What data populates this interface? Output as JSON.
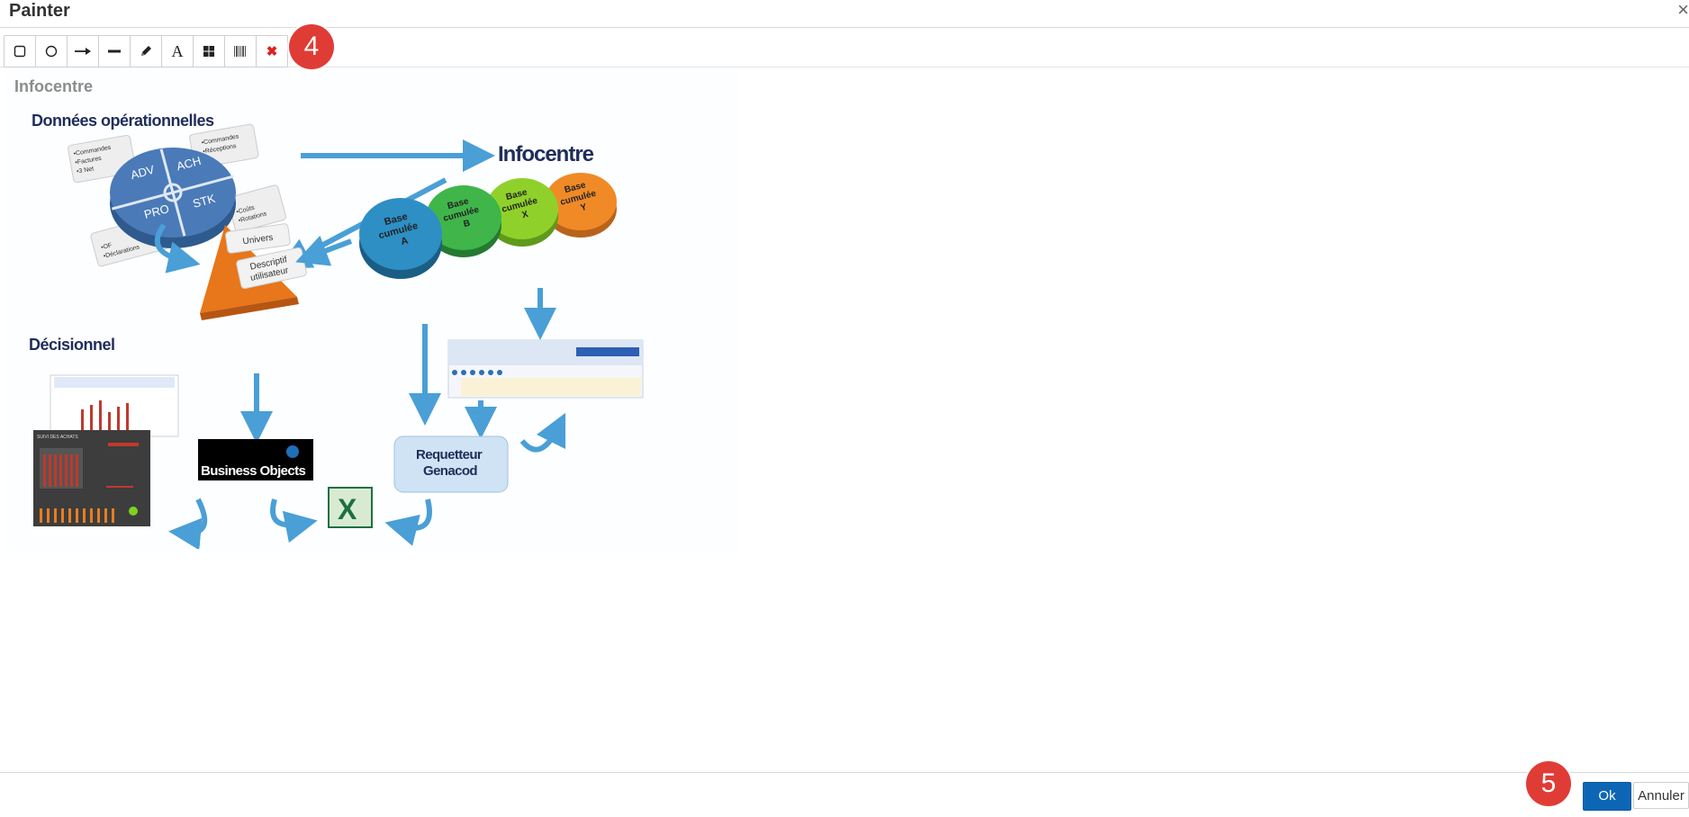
{
  "window": {
    "title": "Painter",
    "close_symbol": "×"
  },
  "toolbar": {
    "tools": [
      {
        "name": "rectangle-tool",
        "icon": "square-icon"
      },
      {
        "name": "circle-tool",
        "icon": "circle-icon"
      },
      {
        "name": "arrow-tool",
        "icon": "arrow-right-icon"
      },
      {
        "name": "line-tool",
        "icon": "line-icon"
      },
      {
        "name": "pencil-tool",
        "icon": "pencil-icon"
      },
      {
        "name": "text-tool",
        "icon": "text-a-icon",
        "glyph": "A"
      },
      {
        "name": "grid-tool",
        "icon": "grid-icon"
      },
      {
        "name": "barcode-tool",
        "icon": "barcode-icon"
      },
      {
        "name": "delete-tool",
        "icon": "red-x-icon",
        "glyph": "✖",
        "color": "#e02020"
      }
    ]
  },
  "badges": {
    "toolbar_step": "4",
    "footer_step": "5",
    "color": "#e03c36"
  },
  "canvas": {
    "title": "Infocentre",
    "diagram": {
      "operational_title": "Données opérationnelles",
      "infocentre_label": "Infocentre",
      "decision_title": "Décisionnel",
      "pie_segments": [
        "ADV",
        "ACH",
        "PRO",
        "STK"
      ],
      "card_commandes_factures": [
        "•Commandes",
        "•Factures",
        "•3 Net"
      ],
      "card_commandes_receptions": [
        "•Commandes",
        "•Réceptions"
      ],
      "card_couts_rotations": [
        "•Coûts",
        "•Rotations"
      ],
      "card_of_declarations": [
        "•OF",
        "•Déclarations"
      ],
      "bases": [
        {
          "line1": "Base",
          "line2": "cumulée",
          "line3": "A",
          "color": "#2e8fc4"
        },
        {
          "line1": "Base",
          "line2": "cumulée",
          "line3": "B",
          "color": "#3fb54a"
        },
        {
          "line1": "Base",
          "line2": "cumulée",
          "line3": "X",
          "color": "#8fd12a"
        },
        {
          "line1": "Base",
          "line2": "cumulée",
          "line3": "Y",
          "color": "#f08a26"
        }
      ],
      "univers_label": "Univers",
      "descriptif_line1": "Descriptif",
      "descriptif_line2": "utilisateur",
      "business_objects_label": "Business Objects",
      "requetteur_line1": "Requetteur",
      "requetteur_line2": "Genacod",
      "excel_letter": "X",
      "dashboard_title": "SUIVI DES ACHATS"
    }
  },
  "footer": {
    "ok_label": "Ok",
    "cancel_label": "Annuler",
    "ok_color": "#0d66b5"
  }
}
